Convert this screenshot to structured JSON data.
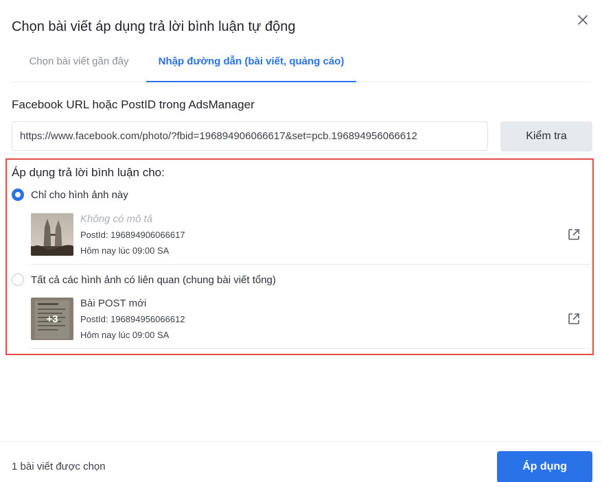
{
  "dialog": {
    "title": "Chọn bài viết áp dụng trả lời bình luận tự động",
    "close_icon": "close-icon"
  },
  "tabs": [
    {
      "label": "Chọn bài viết gần đây",
      "active": false
    },
    {
      "label": "Nhập đường dẫn (bài viết, quảng cáo)",
      "active": true
    }
  ],
  "url_section": {
    "label": "Facebook URL hoặc PostID trong AdsManager",
    "input_value": "https://www.facebook.com/photo/?fbid=196894906066617&set=pcb.196894956066612",
    "check_button": "Kiểm tra"
  },
  "apply_section": {
    "heading": "Áp dụng trả lời bình luận cho:",
    "options": [
      {
        "label": "Chỉ cho hình ảnh này",
        "selected": true,
        "post": {
          "title": "Không có mô tả",
          "post_id": "PostId: 196894906066617",
          "time": "Hôm nay lúc 09:00 SA",
          "open_icon": "external-link-icon"
        }
      },
      {
        "label": "Tất cả các hình ảnh có liên quan (chung bài viết tổng)",
        "selected": false,
        "post": {
          "title": "Bài POST mới",
          "post_id": "PostId: 196894956066612",
          "time": "Hôm nay lúc 09:00 SA",
          "more_count": "+3",
          "open_icon": "external-link-icon"
        }
      }
    ]
  },
  "footer": {
    "selected_count": "1 bài viết được chọn",
    "apply_button": "Áp dụng"
  },
  "colors": {
    "accent": "#2a72e8",
    "highlight_border": "#e34b4b",
    "muted_text": "#8a8f98"
  }
}
